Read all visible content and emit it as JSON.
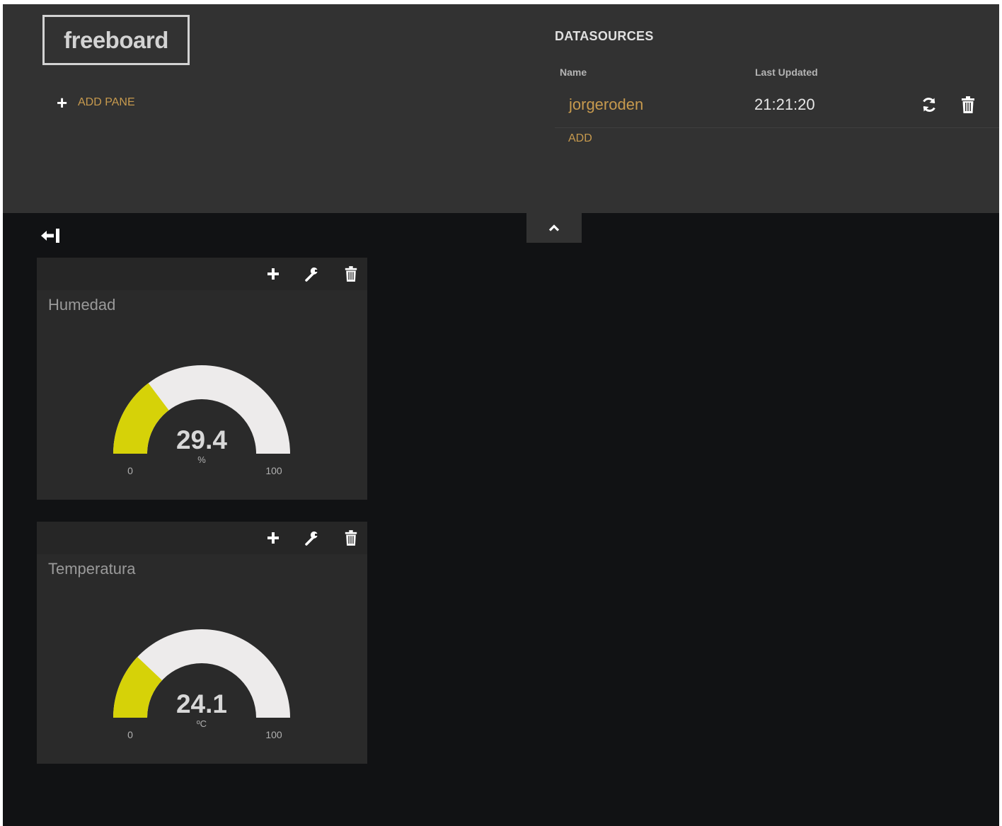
{
  "header": {
    "logo": "freeboard",
    "add_pane_label": "ADD PANE"
  },
  "datasources": {
    "title": "DATASOURCES",
    "columns": {
      "name": "Name",
      "last_updated": "Last Updated"
    },
    "rows": [
      {
        "name": "jorgeroden",
        "last_updated": "21:21:20"
      }
    ],
    "add_label": "ADD"
  },
  "icons": {
    "add_pane": "plus-icon",
    "refresh": "refresh-icon",
    "delete": "trash-icon",
    "toggle": "chevron-up-icon",
    "collapse": "arrow-left-bar-icon",
    "pane_add": "plus-icon",
    "pane_settings": "wrench-icon",
    "pane_delete": "trash-icon"
  },
  "colors": {
    "accent": "#c79a4e",
    "gauge_fill": "#d6d208",
    "gauge_track": "#edebeb",
    "background": "#111214",
    "header": "#323232",
    "pane": "#2a2a2a"
  },
  "panes": [
    {
      "title": "Humedad",
      "value": "29.4",
      "numeric_value": 29.4,
      "units": "%",
      "min": "0",
      "max": "100"
    },
    {
      "title": "Temperatura",
      "value": "24.1",
      "numeric_value": 24.1,
      "units": "ºC",
      "min": "0",
      "max": "100"
    }
  ]
}
